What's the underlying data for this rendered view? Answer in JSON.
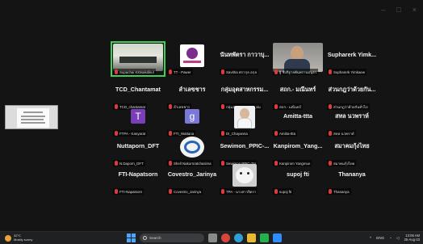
{
  "window_controls": {
    "minimize": "–",
    "maximize": "□",
    "close": "×"
  },
  "participants": [
    {
      "name": "",
      "tag": "Supachai Kittisakdikul"
    },
    {
      "name": "",
      "tag": "TT - Pawer"
    },
    {
      "name": "นันทพัตรา กาวาบุ...",
      "tag": "Savitha ศรากุล อกุล"
    },
    {
      "name": "",
      "tag": "ฐิ ชิงกิฐายพันพรานปนุธร"
    },
    {
      "name": "Supharerk Yimk...",
      "tag": "Supharerk Yimkaew"
    },
    {
      "name": "TCD_Chantamat",
      "tag": "TCD_chantamat"
    },
    {
      "name": "ลำเลขชาร",
      "tag": "ลำเลขชาร"
    },
    {
      "name": "กลุ่มอุตสาหกรรม...",
      "tag": "กลุ่มอุตสาหกรรมก_ห่ม"
    },
    {
      "name": "สถก.- มณีนทร์",
      "tag": "สถก.- มณีนทร์"
    },
    {
      "name": "ส่วนกฎว่าด้วยกัน...",
      "tag": "ส่วนกฎว่าด้วยกันทั่วไป"
    },
    {
      "name": "",
      "tag": "FTPA - Kanyarat"
    },
    {
      "name": "",
      "tag": "FTI_Wattana"
    },
    {
      "name": "",
      "tag": "DI_Chayanna"
    },
    {
      "name": "Amitta-ttta",
      "tag": "Amitta-ttta"
    },
    {
      "name": "สทล นวพราห์",
      "tag": "สทล นวพราห์"
    },
    {
      "name": "Nuttaporn_DFT",
      "tag": "N.Daporn_DFT"
    },
    {
      "name": "",
      "tag": "Shell Nakornratchasima"
    },
    {
      "name": "Sewimon_PPIC-...",
      "tag": "Sewimon PPIC-TH"
    },
    {
      "name": "Kanpirom_Yang...",
      "tag": "Kanpirom Yangmue"
    },
    {
      "name": "สมาคมกุ้งไทย",
      "tag": "สมาคมกุ้งไทย"
    },
    {
      "name": "FTI-Napatsorn",
      "tag": "FTI-Napatsorn"
    },
    {
      "name": "Covestro_Jarinya",
      "tag": "Covestro_Jarinya"
    },
    {
      "name": "",
      "tag": "TPA - นางสาวจิตรา"
    },
    {
      "name": "supoj fti",
      "tag": "supoj fti"
    },
    {
      "name": "Thananya",
      "tag": "Thananya"
    }
  ],
  "avatars": {
    "purple_letter": "T",
    "blue_letter": "g"
  },
  "taskbar": {
    "weather_temp": "32°C",
    "weather_desc": "Mostly sunny",
    "search_placeholder": "Search",
    "lang": "ENG",
    "time": "13:06 AM",
    "date": "25-Aug-23"
  }
}
